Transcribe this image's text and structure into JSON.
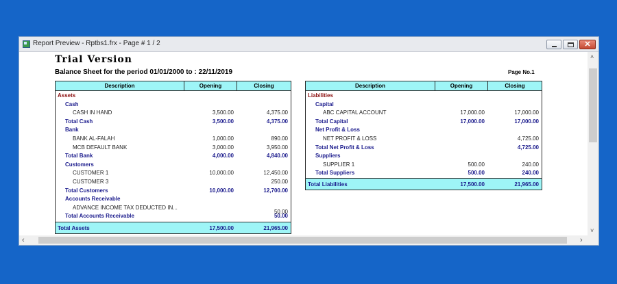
{
  "window": {
    "title": "Report Preview - Rptbs1.frx - Page # 1 / 2",
    "buttons": {
      "minimize": "",
      "maximize": "",
      "close": "✕"
    }
  },
  "report": {
    "title": "Trial Version",
    "period": "Balance Sheet for the period  01/01/2000 to : 22/11/2019",
    "page_no": "Page No.1",
    "columns": [
      "Description",
      "Opening",
      "Closing"
    ]
  },
  "left_table": {
    "rows": [
      {
        "kind": "category",
        "desc": "Assets",
        "opening": "",
        "closing": ""
      },
      {
        "kind": "group",
        "desc": "Cash",
        "opening": "",
        "closing": ""
      },
      {
        "kind": "item",
        "desc": "CASH IN HAND",
        "opening": "3,500.00",
        "closing": "4,375.00"
      },
      {
        "kind": "total",
        "desc": "Total Cash",
        "opening": "3,500.00",
        "closing": "4,375.00"
      },
      {
        "kind": "group",
        "desc": "Bank",
        "opening": "",
        "closing": ""
      },
      {
        "kind": "item",
        "desc": "BANK AL-FALAH",
        "opening": "1,000.00",
        "closing": "890.00"
      },
      {
        "kind": "item",
        "desc": "MCB DEFAULT BANK",
        "opening": "3,000.00",
        "closing": "3,950.00"
      },
      {
        "kind": "total",
        "desc": "Total Bank",
        "opening": "4,000.00",
        "closing": "4,840.00"
      },
      {
        "kind": "group",
        "desc": "Customers",
        "opening": "",
        "closing": ""
      },
      {
        "kind": "item",
        "desc": "CUSTOMER 1",
        "opening": "10,000.00",
        "closing": "12,450.00"
      },
      {
        "kind": "item",
        "desc": "CUSTOMER 3",
        "opening": "",
        "closing": "250.00"
      },
      {
        "kind": "total",
        "desc": "Total Customers",
        "opening": "10,000.00",
        "closing": "12,700.00"
      },
      {
        "kind": "group",
        "desc": "Accounts Receivable",
        "opening": "",
        "closing": ""
      },
      {
        "kind": "item",
        "desc": "ADVANCE INCOME TAX DEDUCTED IN...",
        "opening": "",
        "closing": "50.00",
        "value_offset": 1
      },
      {
        "kind": "total",
        "desc": "Total Accounts Receivable",
        "opening": "",
        "closing": "50.00"
      }
    ],
    "footer": {
      "desc": "Total Assets",
      "opening": "17,500.00",
      "closing": "21,965.00"
    }
  },
  "right_table": {
    "rows": [
      {
        "kind": "category",
        "desc": "Liabilities",
        "opening": "",
        "closing": ""
      },
      {
        "kind": "group",
        "desc": "Capital",
        "opening": "",
        "closing": ""
      },
      {
        "kind": "item",
        "desc": "ABC CAPITAL ACCOUNT",
        "opening": "17,000.00",
        "closing": "17,000.00"
      },
      {
        "kind": "total",
        "desc": "Total Capital",
        "opening": "17,000.00",
        "closing": "17,000.00"
      },
      {
        "kind": "group",
        "desc": "Net Profit & Loss",
        "opening": "",
        "closing": ""
      },
      {
        "kind": "item",
        "desc": "NET PROFIT & LOSS",
        "opening": "",
        "closing": "4,725.00"
      },
      {
        "kind": "total",
        "desc": "Total Net Profit & Loss",
        "opening": "",
        "closing": "4,725.00"
      },
      {
        "kind": "group",
        "desc": "Suppliers",
        "opening": "",
        "closing": ""
      },
      {
        "kind": "item",
        "desc": "SUPPLIER 1",
        "opening": "500.00",
        "closing": "240.00"
      },
      {
        "kind": "total",
        "desc": "Total Suppliers",
        "opening": "500.00",
        "closing": "240.00"
      }
    ],
    "footer": {
      "desc": "Total Liabilities",
      "opening": "17,500.00",
      "closing": "21,965.00"
    }
  },
  "colors": {
    "header_bg": "#9ef5f7",
    "category": "#8c1010",
    "group_total": "#1a1a8c"
  }
}
